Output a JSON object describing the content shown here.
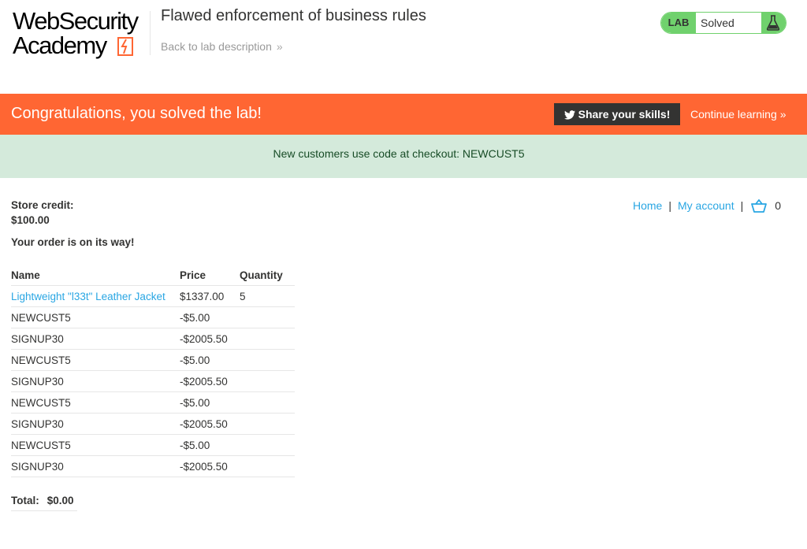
{
  "header": {
    "logo_line1": "WebSecurity",
    "logo_line2": "Academy",
    "lab_title": "Flawed enforcement of business rules",
    "back_link": "Back to lab description",
    "status_badge": "LAB",
    "status_text": "Solved",
    "status_icon": "flask-icon"
  },
  "banner": {
    "message": "Congratulations, you solved the lab!",
    "share_label": "Share your skills!",
    "share_icon": "twitter-icon",
    "continue_label": "Continue learning"
  },
  "notice": {
    "text": "New customers use code at checkout: NEWCUST5"
  },
  "nav": {
    "home": "Home",
    "account": "My account",
    "separator": "|",
    "cart_count": "0"
  },
  "account": {
    "credit_label": "Store credit:",
    "credit_value": "$100.00",
    "order_message": "Your order is on its way!"
  },
  "table": {
    "headers": [
      "Name",
      "Price",
      "Quantity"
    ],
    "rows": [
      {
        "name": "Lightweight \"l33t\" Leather Jacket",
        "price": "$1337.00",
        "qty": "5",
        "link": true
      },
      {
        "name": "NEWCUST5",
        "price": "-$5.00",
        "qty": ""
      },
      {
        "name": "SIGNUP30",
        "price": "-$2005.50",
        "qty": ""
      },
      {
        "name": "NEWCUST5",
        "price": "-$5.00",
        "qty": ""
      },
      {
        "name": "SIGNUP30",
        "price": "-$2005.50",
        "qty": ""
      },
      {
        "name": "NEWCUST5",
        "price": "-$5.00",
        "qty": ""
      },
      {
        "name": "SIGNUP30",
        "price": "-$2005.50",
        "qty": ""
      },
      {
        "name": "NEWCUST5",
        "price": "-$5.00",
        "qty": ""
      },
      {
        "name": "SIGNUP30",
        "price": "-$2005.50",
        "qty": ""
      }
    ]
  },
  "total": {
    "label": "Total:",
    "value": "$0.00"
  },
  "colors": {
    "brand_orange": "#ff6633",
    "solved_green": "#70d16d",
    "link_blue": "#29a6e3",
    "notice_bg": "#d4eadb",
    "dark": "#333332"
  }
}
